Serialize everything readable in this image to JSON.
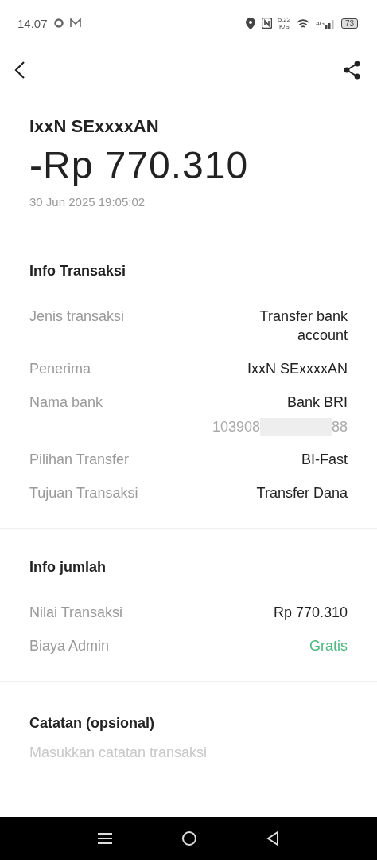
{
  "status_bar": {
    "time": "14.07",
    "speed": "5,22",
    "speed_unit": "K/S",
    "network": "4G",
    "battery": "73"
  },
  "header": {
    "name": "IxxN SExxxxAN",
    "amount": "-Rp 770.310",
    "date": "30 Jun 2025 19:05:02"
  },
  "sections": [
    {
      "title": "Info Transaksi",
      "rows": [
        {
          "label": "Jenis transaksi",
          "value": "Transfer bank account"
        },
        {
          "label": "Penerima",
          "value": "IxxN SExxxxAN"
        },
        {
          "label": "Nama bank",
          "value": "Bank BRI",
          "account_start": "103908",
          "account_end": "88"
        },
        {
          "label": "Pilihan Transfer",
          "value": "BI-Fast"
        },
        {
          "label": "Tujuan Transaksi",
          "value": "Transfer Dana"
        }
      ]
    },
    {
      "title": "Info jumlah",
      "rows": [
        {
          "label": "Nilai Transaksi",
          "value": "Rp 770.310"
        },
        {
          "label": "Biaya Admin",
          "value": "Gratis",
          "color": "#4cb87e"
        }
      ]
    }
  ],
  "note": {
    "title": "Catatan (opsional)",
    "placeholder": "Masukkan catatan transaksi"
  }
}
